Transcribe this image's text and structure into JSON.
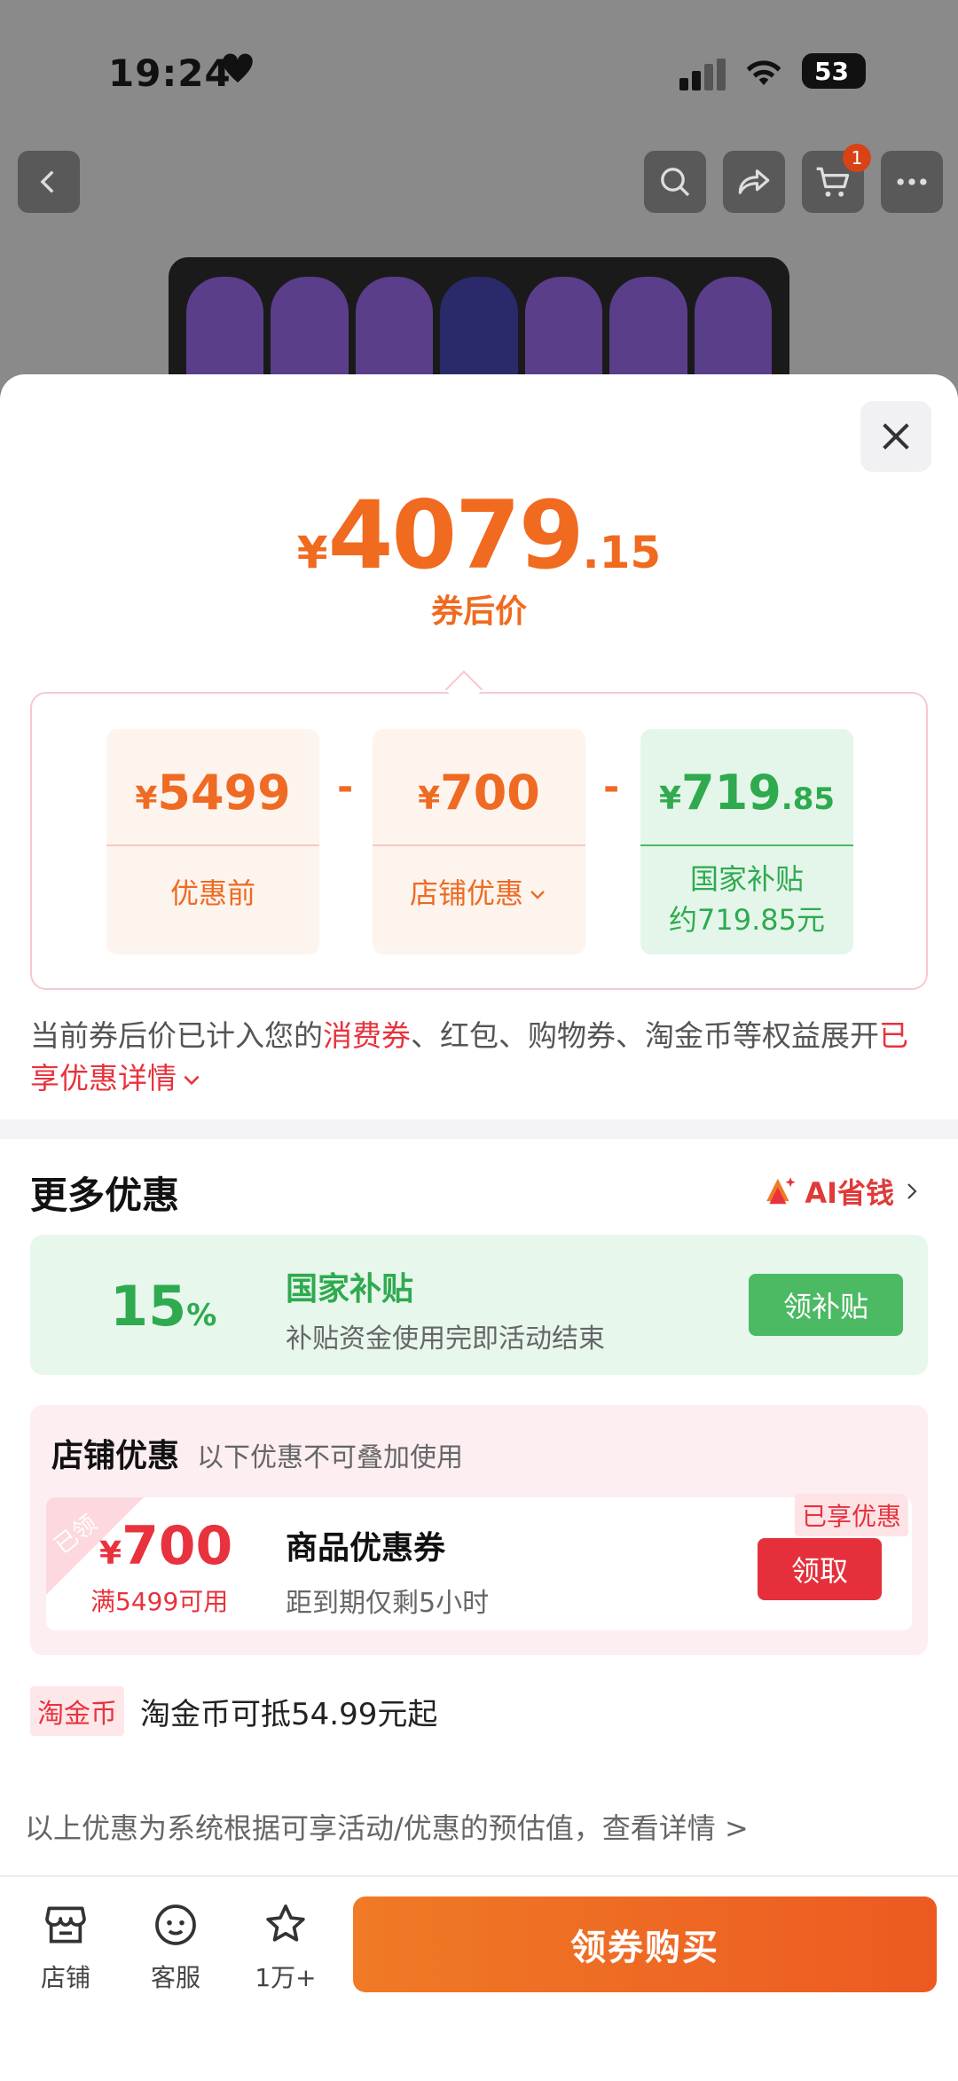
{
  "status": {
    "time": "19:24",
    "battery": "53"
  },
  "background_page": {
    "cart_count": "1"
  },
  "price": {
    "yen": "¥",
    "integer": "4079",
    "decimal": ".15",
    "caption": "券后价"
  },
  "breakdown": {
    "original": {
      "yen": "¥",
      "value": "5499",
      "label": "优惠前"
    },
    "minus1": "-",
    "store": {
      "yen": "¥",
      "value": "700",
      "label": "店铺优惠"
    },
    "minus2": "-",
    "subsidy": {
      "yen": "¥",
      "value": "719",
      "decimal": ".85",
      "label_line1": "国家补贴",
      "label_line2": "约719.85元"
    }
  },
  "note": {
    "part1": "当前券后价已计入您的",
    "highlight1": "消费券",
    "part2": "、红包、购物券、淘金币等权益展开",
    "highlight2": "已享优惠详情"
  },
  "more_offers": {
    "title": "更多优惠",
    "ai_link": "AI省钱",
    "subsidy_card": {
      "percent": "15",
      "percent_sign": "%",
      "title": "国家补贴",
      "desc": "补贴资金使用完即活动结束",
      "button": "领补贴"
    },
    "store_offer": {
      "title": "店铺优惠",
      "subtitle": "以下优惠不可叠加使用",
      "coupon": {
        "claimed_tag": "已领",
        "yen": "¥",
        "amount": "700",
        "condition": "满5499可用",
        "name": "商品优惠券",
        "expiry": "距到期仅剩5小时",
        "enjoyed_tag": "已享优惠",
        "button": "领取"
      }
    },
    "coin": {
      "tag": "淘金币",
      "text": "淘金币可抵54.99元起"
    }
  },
  "disclaimer": "以上优惠为系统根据可享活动/优惠的预估值，查看详情 >",
  "bottom_bar": {
    "store": "店铺",
    "service": "客服",
    "favorite": "1万+",
    "buy": "领券购买"
  }
}
